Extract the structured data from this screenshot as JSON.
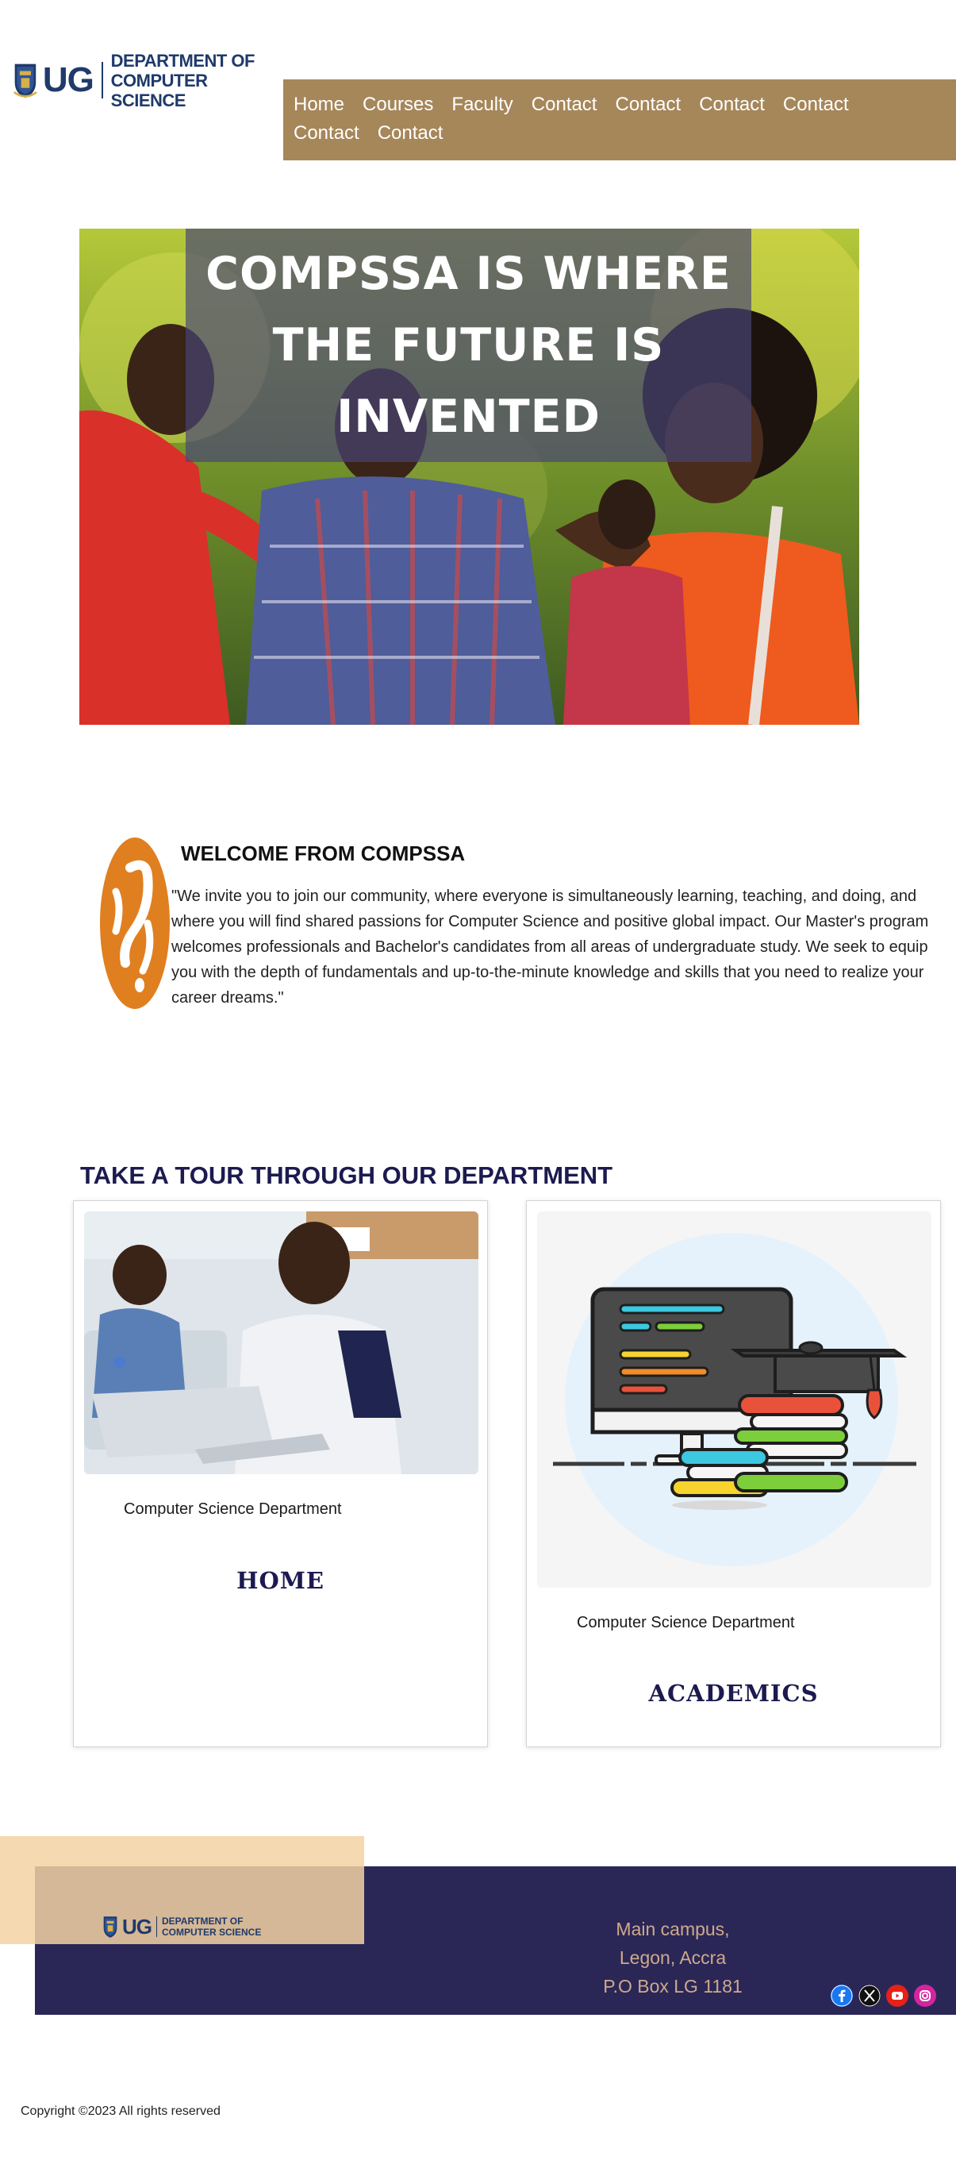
{
  "header": {
    "logo_short": "UG",
    "logo_line1": "DEPARTMENT OF",
    "logo_line2": "COMPUTER SCIENCE",
    "brand_color": "#1f3a6b"
  },
  "nav": {
    "items": [
      "Home",
      "Courses",
      "Faculty",
      "Contact",
      "Contact",
      "Contact",
      "Contact",
      "Contact",
      "Contact"
    ],
    "background": "#a6875a"
  },
  "hero": {
    "title": "COMPSSA IS WHERE THE FUTURE IS INVENTED",
    "overlay_color": "#484676"
  },
  "welcome": {
    "heading": "WELCOME FROM COMPSSA",
    "body": "\"We invite you to join our community, where everyone is simultaneously learning, teaching, and doing, and where you will find shared passions for Computer Science and positive global impact. Our Master's program welcomes professionals and Bachelor's candidates from all areas of undergraduate study. We seek to equip you with the depth of fundamentals and up-to-the-minute knowledge and skills that you need to realize your career dreams.\"",
    "logo_color": "#e07f1f"
  },
  "tour": {
    "heading": "TAKE A TOUR THROUGH OUR DEPARTMENT",
    "cards": [
      {
        "caption": "Computer Science Department",
        "title": "HOME",
        "image": "students-at-laptops-photo"
      },
      {
        "caption": "Computer Science Department",
        "title": "ACADEMICS",
        "image": "computer-books-graduation-cap-illustration"
      }
    ]
  },
  "footer": {
    "logo_short": "UG",
    "logo_line1": "DEPARTMENT OF",
    "logo_line2": "COMPUTER SCIENCE",
    "address": [
      "Main campus,",
      "Legon, Accra",
      "P.O Box LG 1181"
    ],
    "social": [
      "facebook-icon",
      "x-twitter-icon",
      "youtube-icon",
      "instagram-icon"
    ],
    "bar_color": "#2a2757",
    "accent_color": "#f3d2a2"
  },
  "copyright": "Copyright ©2023 All rights reserved"
}
